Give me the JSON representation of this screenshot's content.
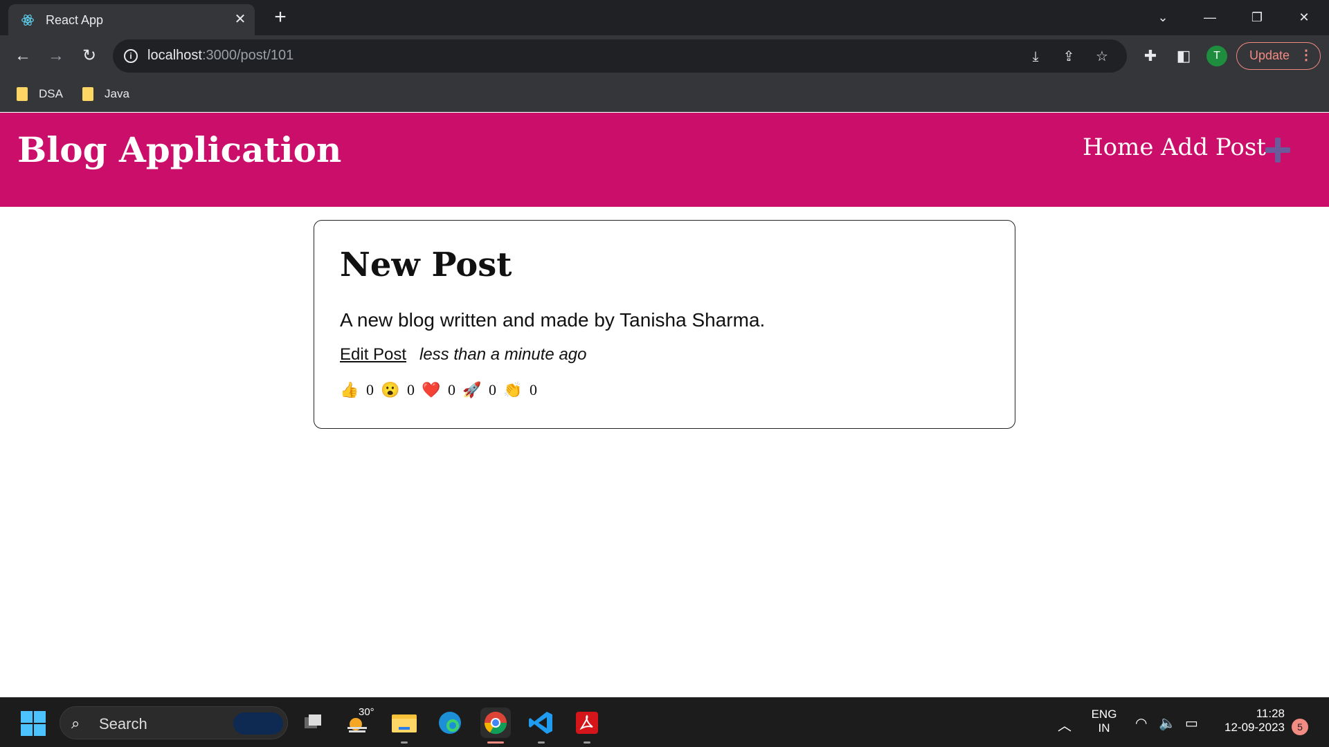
{
  "browser": {
    "tab_title": "React App",
    "url_host": "localhost",
    "url_path": ":3000/post/101",
    "avatar_initial": "T",
    "update_label": "Update",
    "bookmarks": [
      {
        "label": "DSA"
      },
      {
        "label": "Java"
      }
    ]
  },
  "app": {
    "brand": "Blog Application",
    "nav": {
      "home": "Home",
      "add_post": "Add Post"
    },
    "accent_color": "#cc0e6b"
  },
  "post": {
    "title": "New Post",
    "body": "A new blog written and made by Tanisha Sharma.",
    "edit_label": "Edit Post",
    "timestamp": "less than a minute ago",
    "reactions": [
      {
        "name": "thumbs-up",
        "emoji": "👍",
        "count": "0"
      },
      {
        "name": "wow",
        "emoji": "😮",
        "count": "0"
      },
      {
        "name": "heart",
        "emoji": "❤️",
        "count": "0"
      },
      {
        "name": "rocket",
        "emoji": "🚀",
        "count": "0"
      },
      {
        "name": "clap",
        "emoji": "👏",
        "count": "0"
      }
    ]
  },
  "taskbar": {
    "search_placeholder": "Search",
    "weather_temp": "30°",
    "lang_top": "ENG",
    "lang_bottom": "IN",
    "time": "11:28",
    "date": "12-09-2023",
    "notification_count": "5"
  }
}
